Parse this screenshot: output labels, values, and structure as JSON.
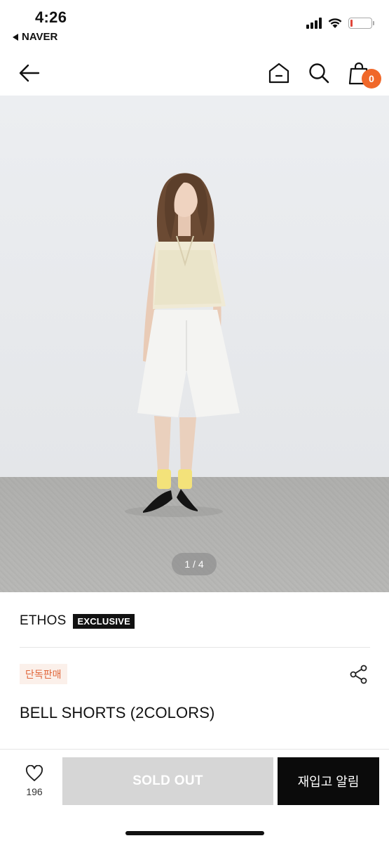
{
  "status_bar": {
    "time": "4:26",
    "back_app": "NAVER",
    "battery_color": "#e0463a"
  },
  "header": {
    "back_icon": "arrow-left-icon",
    "home_icon": "home-icon",
    "search_icon": "search-icon",
    "cart_icon": "shopping-bag-icon",
    "cart_count": "0",
    "badge_color": "#f0682a"
  },
  "gallery": {
    "indicator": "1 / 4"
  },
  "product": {
    "brand": "ETHOS",
    "exclusive_label": "EXCLUSIVE",
    "tag": "단독판매",
    "name": "BELL SHORTS (2COLORS)",
    "share_icon": "share-icon"
  },
  "bottom_bar": {
    "like_icon": "heart-icon",
    "like_count": "196",
    "sold_out_label": "SOLD OUT",
    "restock_label": "재입고 알림"
  }
}
